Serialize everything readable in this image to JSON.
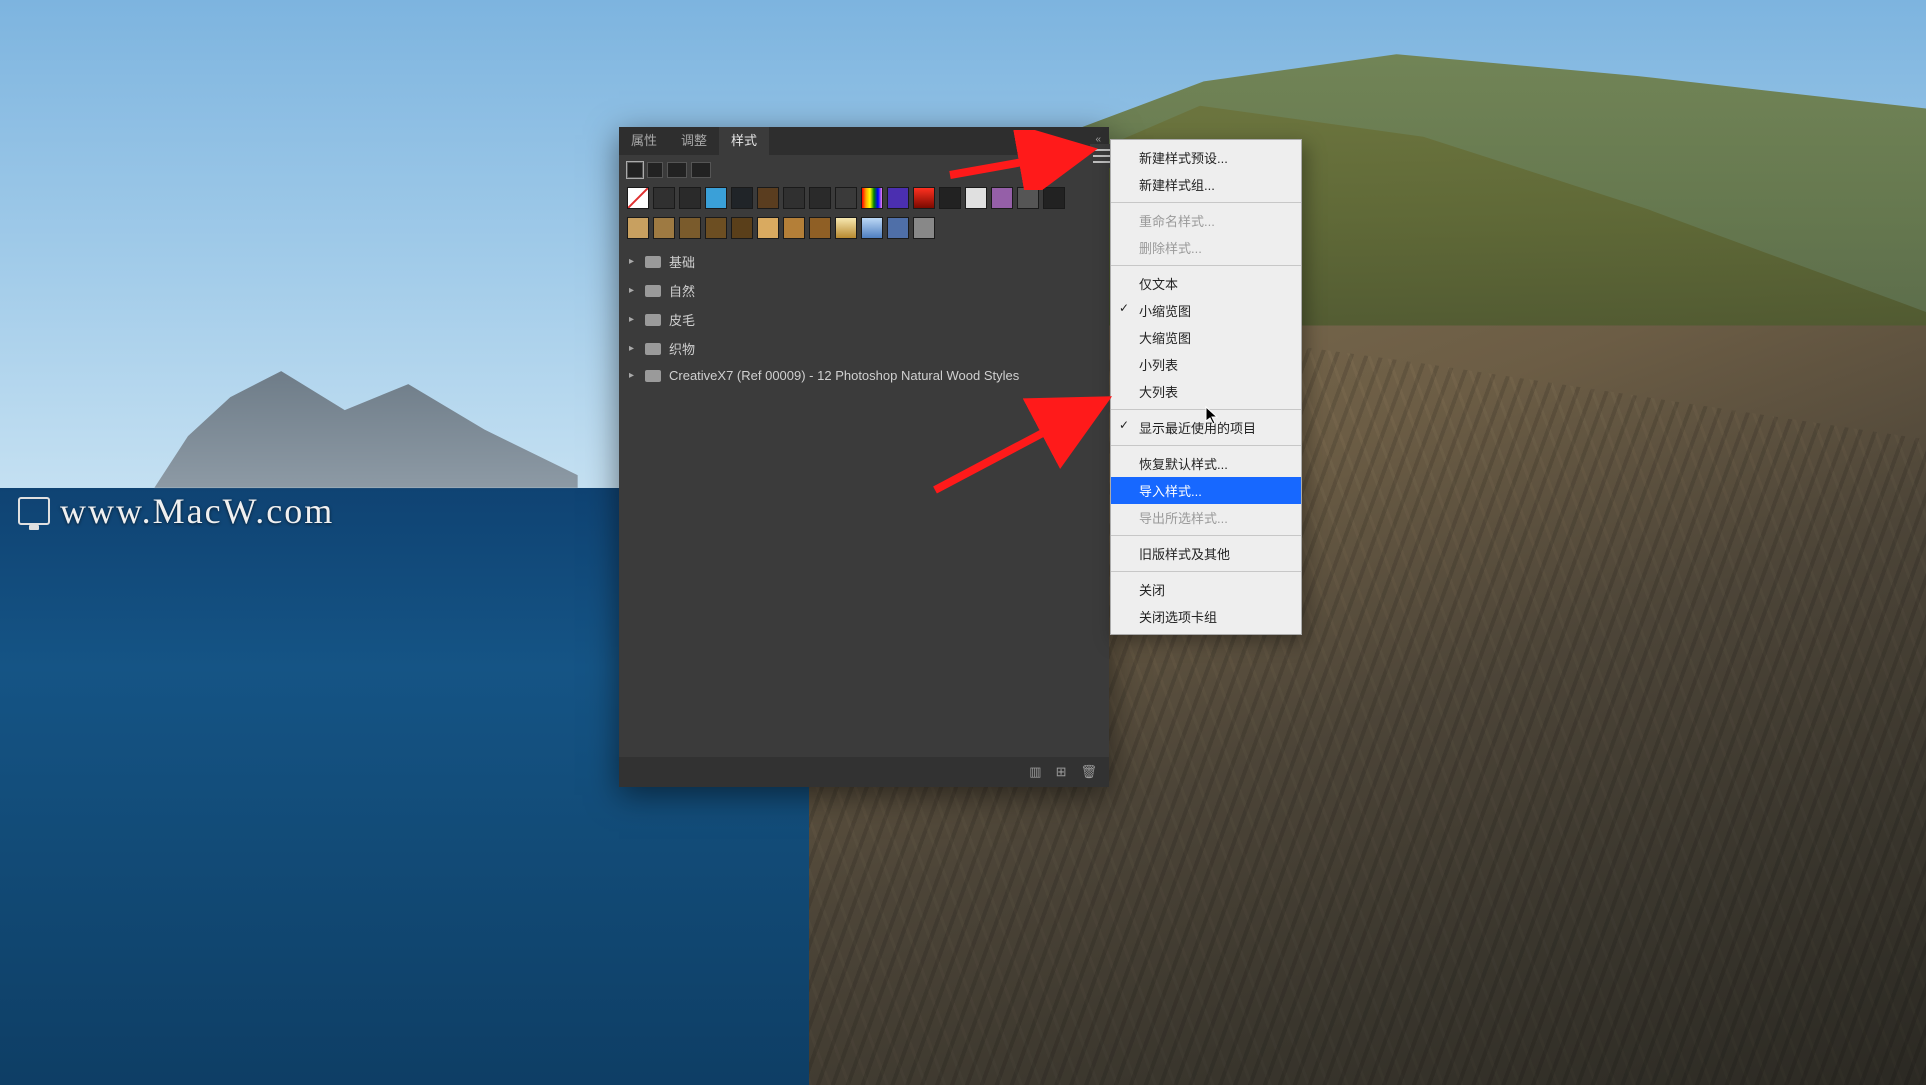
{
  "watermark": "www.MacW.com",
  "panel": {
    "tabs": [
      {
        "label": "属性",
        "active": false
      },
      {
        "label": "调整",
        "active": false
      },
      {
        "label": "样式",
        "active": true
      }
    ],
    "swatches_row1": [
      "#f5f5f5|none",
      "#303030",
      "#2a2a2a",
      "#3aa0d8",
      "#202428",
      "#5a3d1f",
      "#303030",
      "#2a2a2a",
      "#3a3a3a",
      "rainbow",
      "#4b2fb0",
      "redgrad",
      "#222",
      "#e0e0e0",
      "#955fa8",
      "#555555",
      "#222222"
    ],
    "swatches_row2": [
      "#c8a060",
      "#9e7a42",
      "#7a5b2c",
      "#6c4e22",
      "#5a3f1a",
      "#d9aa60",
      "#b47f38",
      "#8f5f25",
      "#f3e2bb goldgrad",
      "#7aa4e0 skygrad",
      "#4f6fa8",
      "#888888"
    ],
    "folders": [
      "基础",
      "自然",
      "皮毛",
      "织物",
      "CreativeX7 (Ref 00009) - 12 Photoshop Natural Wood Styles"
    ]
  },
  "menu": {
    "items": [
      {
        "label": "新建样式预设...",
        "type": "item"
      },
      {
        "label": "新建样式组...",
        "type": "item"
      },
      {
        "type": "sep"
      },
      {
        "label": "重命名样式...",
        "type": "item",
        "disabled": true
      },
      {
        "label": "删除样式...",
        "type": "item",
        "disabled": true
      },
      {
        "type": "sep"
      },
      {
        "label": "仅文本",
        "type": "item"
      },
      {
        "label": "小缩览图",
        "type": "item",
        "checked": true
      },
      {
        "label": "大缩览图",
        "type": "item"
      },
      {
        "label": "小列表",
        "type": "item"
      },
      {
        "label": "大列表",
        "type": "item"
      },
      {
        "type": "sep"
      },
      {
        "label": "显示最近使用的项目",
        "type": "item",
        "checked": true
      },
      {
        "type": "sep"
      },
      {
        "label": "恢复默认样式...",
        "type": "item"
      },
      {
        "label": "导入样式...",
        "type": "item",
        "selected": true
      },
      {
        "label": "导出所选样式...",
        "type": "item",
        "disabled": true
      },
      {
        "type": "sep"
      },
      {
        "label": "旧版样式及其他",
        "type": "item"
      },
      {
        "type": "sep"
      },
      {
        "label": "关闭",
        "type": "item"
      },
      {
        "label": "关闭选项卡组",
        "type": "item"
      }
    ]
  },
  "footer_icons": [
    "folder",
    "new",
    "trash"
  ]
}
